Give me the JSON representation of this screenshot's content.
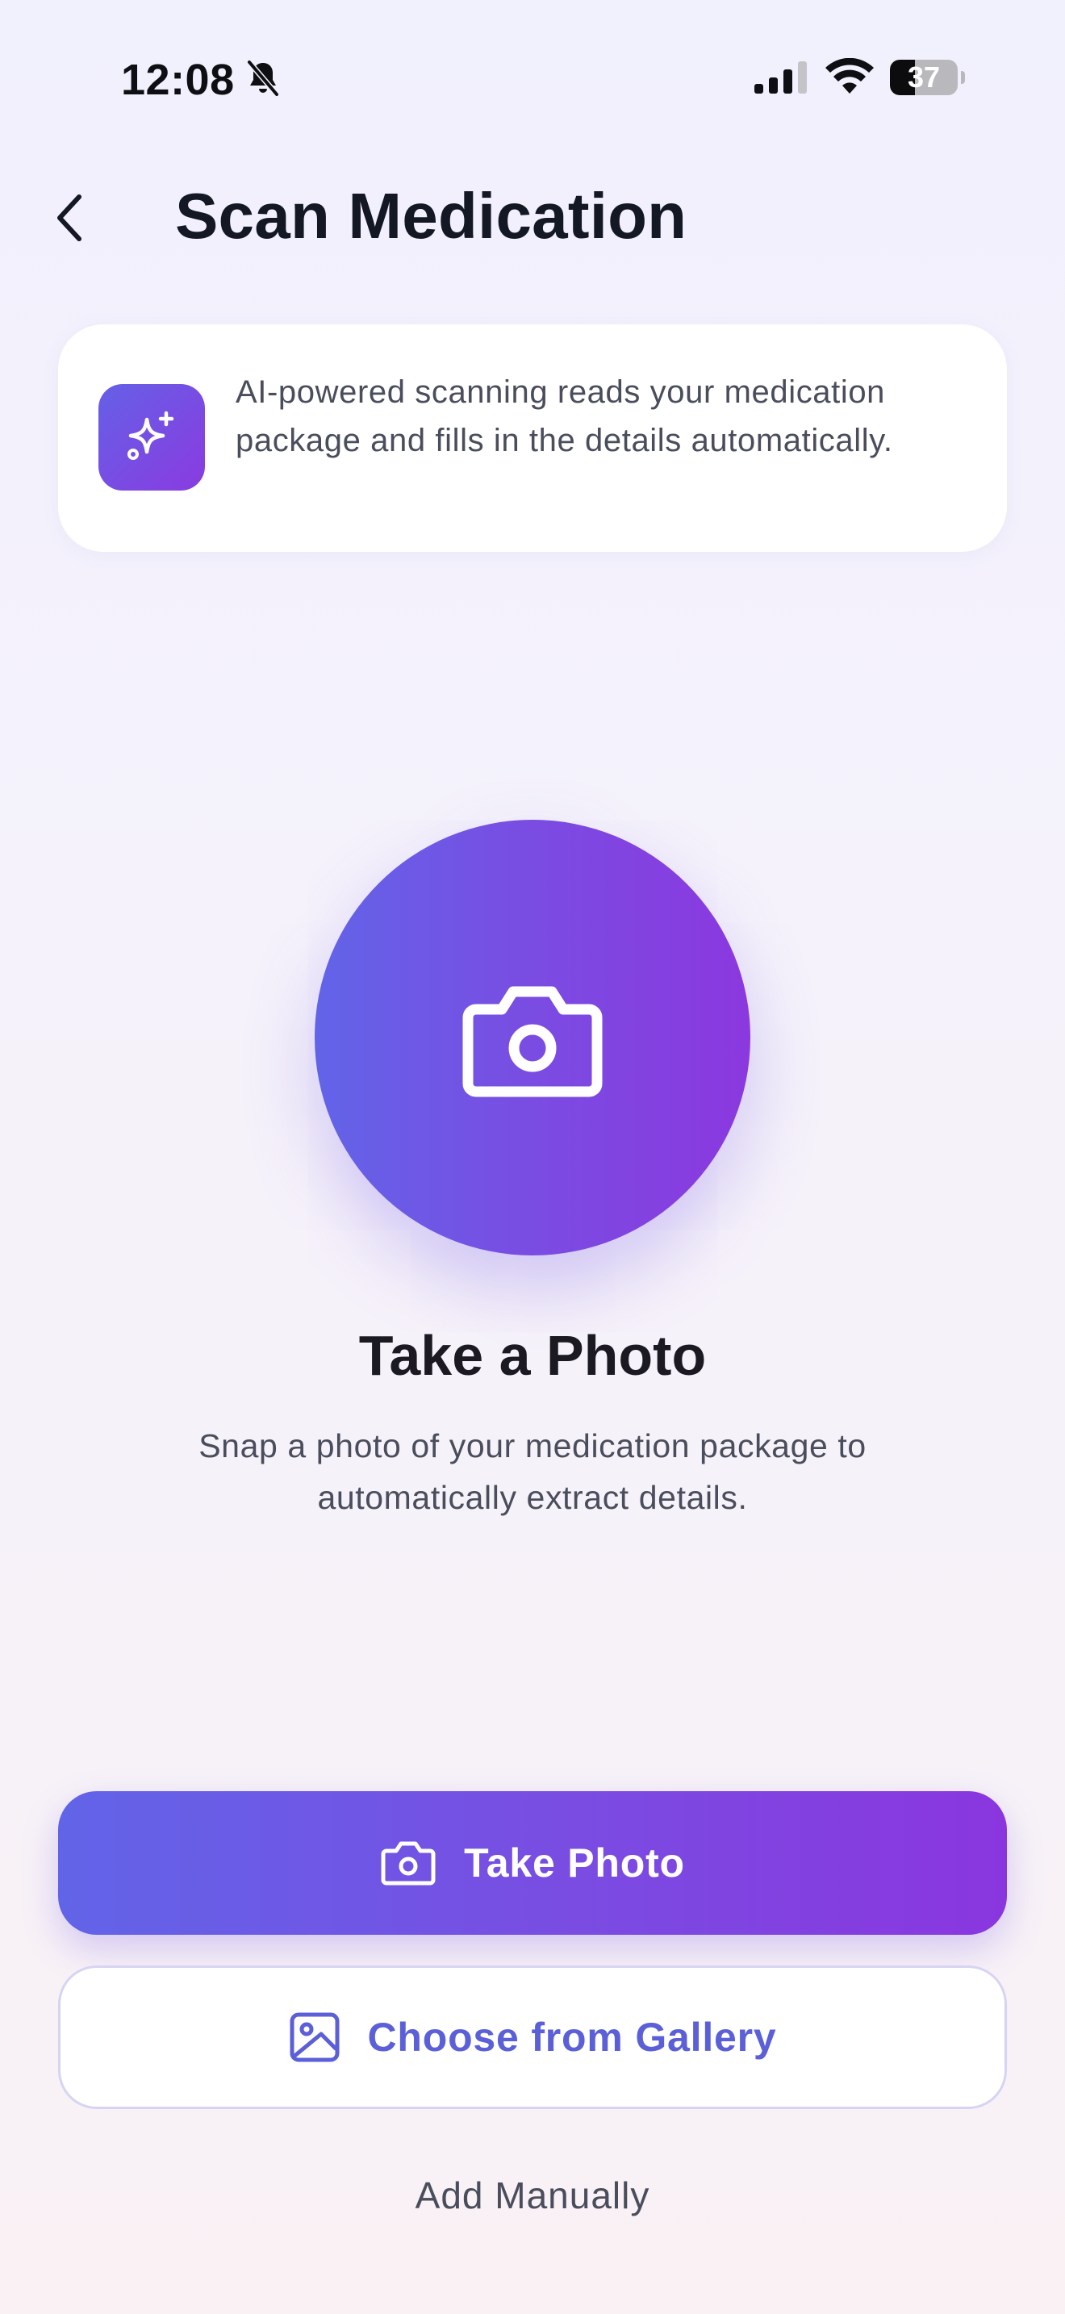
{
  "status_bar": {
    "time": "12:08",
    "battery_level": 37,
    "battery_text": "37",
    "icons": [
      "bell-slash-icon",
      "cellular-signal-icon",
      "wifi-icon",
      "battery-icon"
    ]
  },
  "header": {
    "back_icon": "chevron-left-icon",
    "title": "Scan Medication"
  },
  "info_card": {
    "icon": "sparkles-icon",
    "text": "AI-powered scanning reads your medication package and fills in the details automatically."
  },
  "hero": {
    "icon": "camera-icon",
    "title": "Take a Photo",
    "description": "Snap a photo of your medication package to automatically extract details."
  },
  "actions": {
    "take_photo": {
      "label": "Take Photo",
      "icon": "camera-icon"
    },
    "gallery": {
      "label": "Choose from Gallery",
      "icon": "image-icon"
    },
    "manual": {
      "label": "Add Manually"
    }
  },
  "colors": {
    "accent_start": "#6264e8",
    "accent_end": "#8a36df",
    "gallery_text": "#5b5fd8",
    "title_text": "#141824",
    "body_text": "#4a4d5c"
  }
}
